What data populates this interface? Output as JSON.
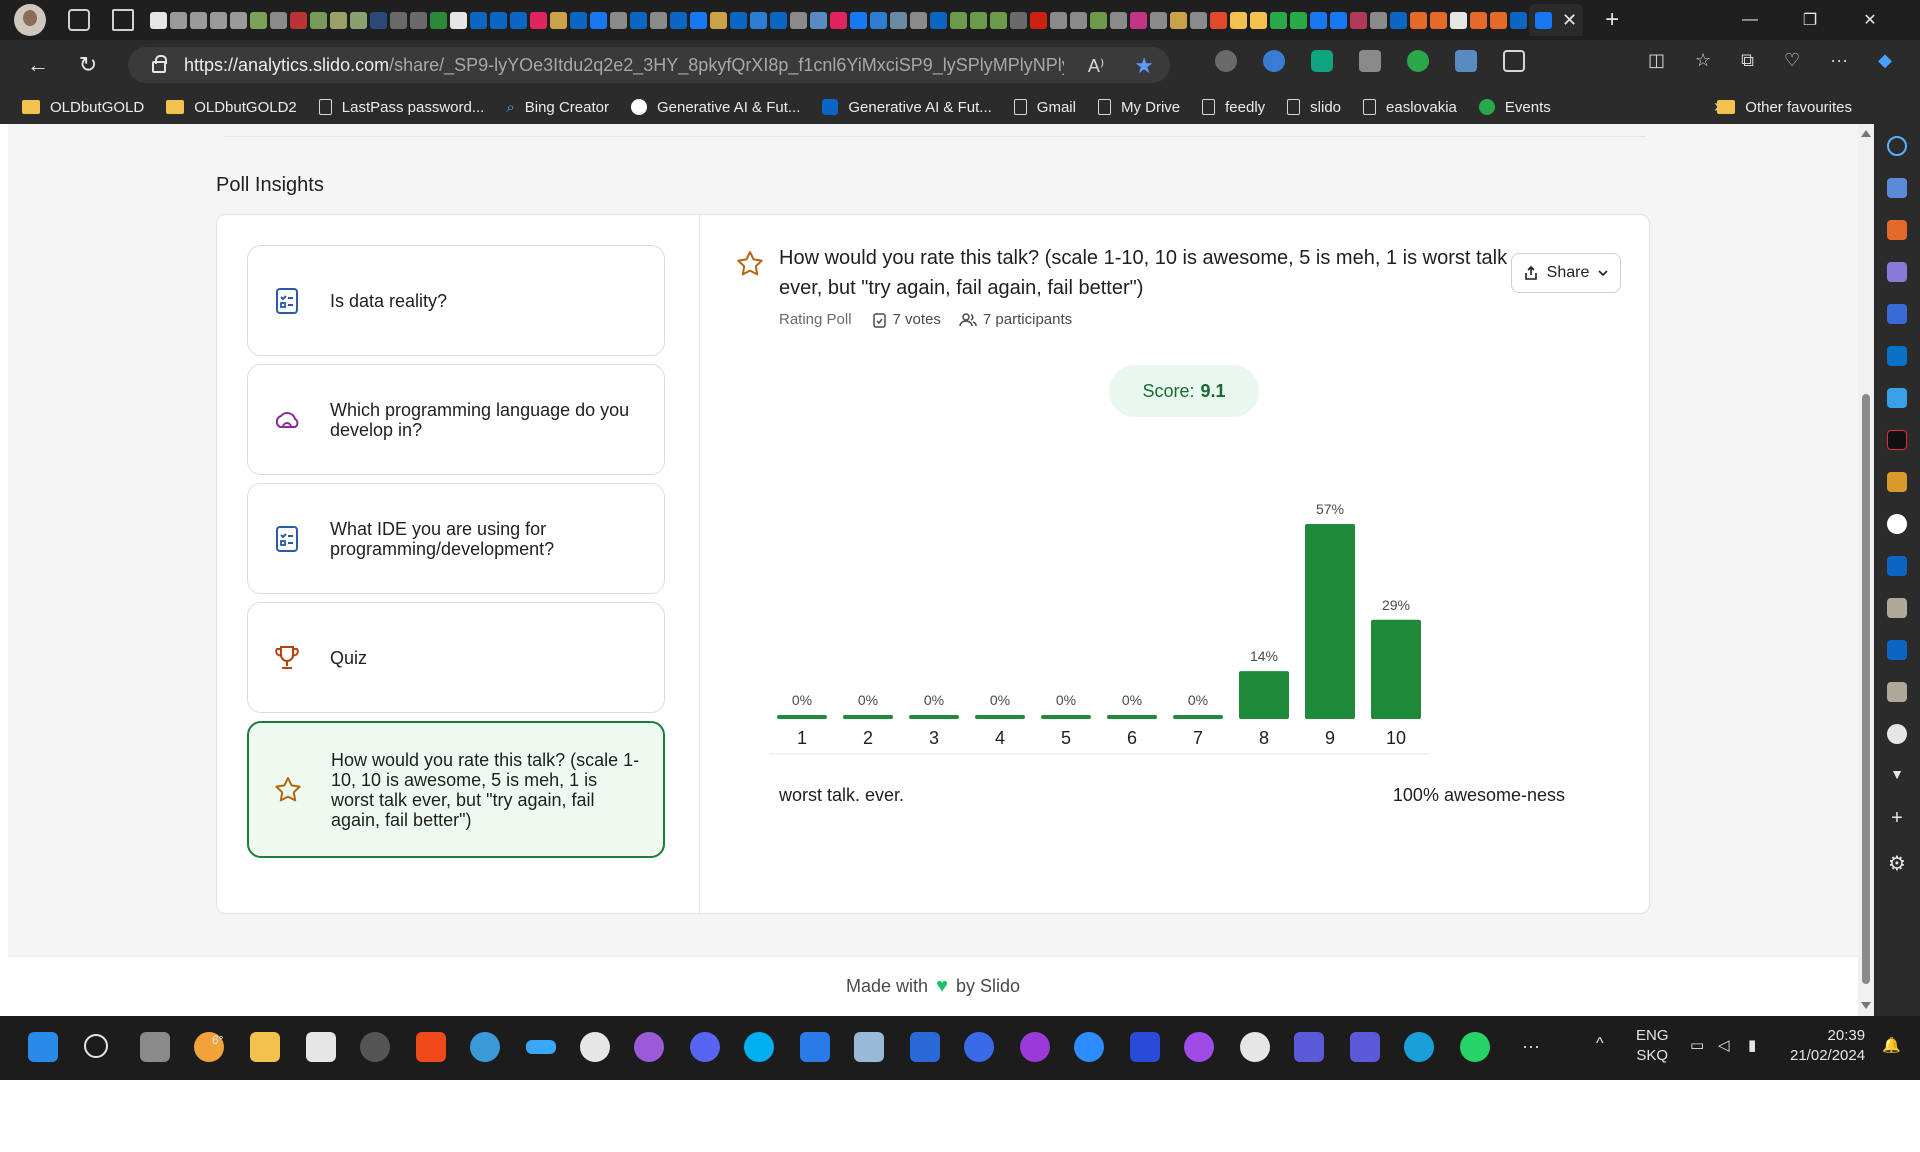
{
  "browser": {
    "url_host": "https://analytics.slido.com",
    "url_path": "/share/_SP9-lyYOe3Itdu2q2e2_3HY_8pkyfQrXI8p_f1cnl6YiMxciSP9_lySPlyMPlyNPlyZOe0y...",
    "tab_close": "✕",
    "new_tab": "+",
    "bookmarks": [
      {
        "label": "OLDbutGOLD",
        "icon": "folder-icon"
      },
      {
        "label": "OLDbutGOLD2",
        "icon": "folder-icon"
      },
      {
        "label": "LastPass password...",
        "icon": "page-icon"
      },
      {
        "label": "Bing Creator",
        "icon": "search-icon"
      },
      {
        "label": "Generative AI & Fut...",
        "icon": "medium-icon"
      },
      {
        "label": "Generative AI & Fut...",
        "icon": "linkedin-icon"
      },
      {
        "label": "Gmail",
        "icon": "page-icon"
      },
      {
        "label": "My Drive",
        "icon": "page-icon"
      },
      {
        "label": "feedly",
        "icon": "page-icon"
      },
      {
        "label": "slido",
        "icon": "page-icon"
      },
      {
        "label": "easlovakia",
        "icon": "page-icon"
      },
      {
        "label": "Events",
        "icon": "slido-s-icon"
      }
    ],
    "bookmarks_other": "Other favourites"
  },
  "page": {
    "section_title": "Poll Insights",
    "polls": [
      {
        "label": "Is data reality?",
        "icon": "checklist-icon",
        "active": false
      },
      {
        "label": "Which programming language do you develop in?",
        "icon": "cloud-icon",
        "active": false
      },
      {
        "label": "What IDE you are using for programming/development?",
        "icon": "checklist-icon",
        "active": false
      },
      {
        "label": "Quiz",
        "icon": "trophy-icon",
        "active": false
      },
      {
        "label": "How would you rate this talk? (scale 1-10, 10 is awesome, 5 is meh, 1 is worst talk ever, but \"try again, fail again, fail better\")",
        "icon": "star-icon",
        "active": true
      }
    ],
    "question": {
      "title": "How would you rate this talk? (scale 1-10, 10 is awesome, 5 is meh, 1 is worst talk ever, but \"try again, fail again, fail better\")",
      "type": "Rating Poll",
      "votes": "7 votes",
      "participants": "7 participants",
      "share_label": "Share",
      "score_label": "Score:",
      "score_value": "9.1",
      "scale_min_label": "worst talk. ever.",
      "scale_max_label": "100% awesome-ness"
    },
    "footer_prefix": "Made with",
    "footer_suffix": "by Slido"
  },
  "chart_data": {
    "type": "bar",
    "categories": [
      "1",
      "2",
      "3",
      "4",
      "5",
      "6",
      "7",
      "8",
      "9",
      "10"
    ],
    "values": [
      0,
      0,
      0,
      0,
      0,
      0,
      0,
      14,
      57,
      29
    ],
    "value_labels": [
      "0%",
      "0%",
      "0%",
      "0%",
      "0%",
      "0%",
      "0%",
      "14%",
      "57%",
      "29%"
    ],
    "ylim": [
      0,
      57
    ],
    "color": "#1e8a3a"
  },
  "taskbar": {
    "weather": "6°",
    "lang_top": "ENG",
    "lang_bottom": "SKQ",
    "time": "20:39",
    "date": "21/02/2024"
  },
  "colors": {
    "accent": "#1e8a3a",
    "active_bg": "#eefaf0",
    "score_bg": "#eaf7ee"
  }
}
